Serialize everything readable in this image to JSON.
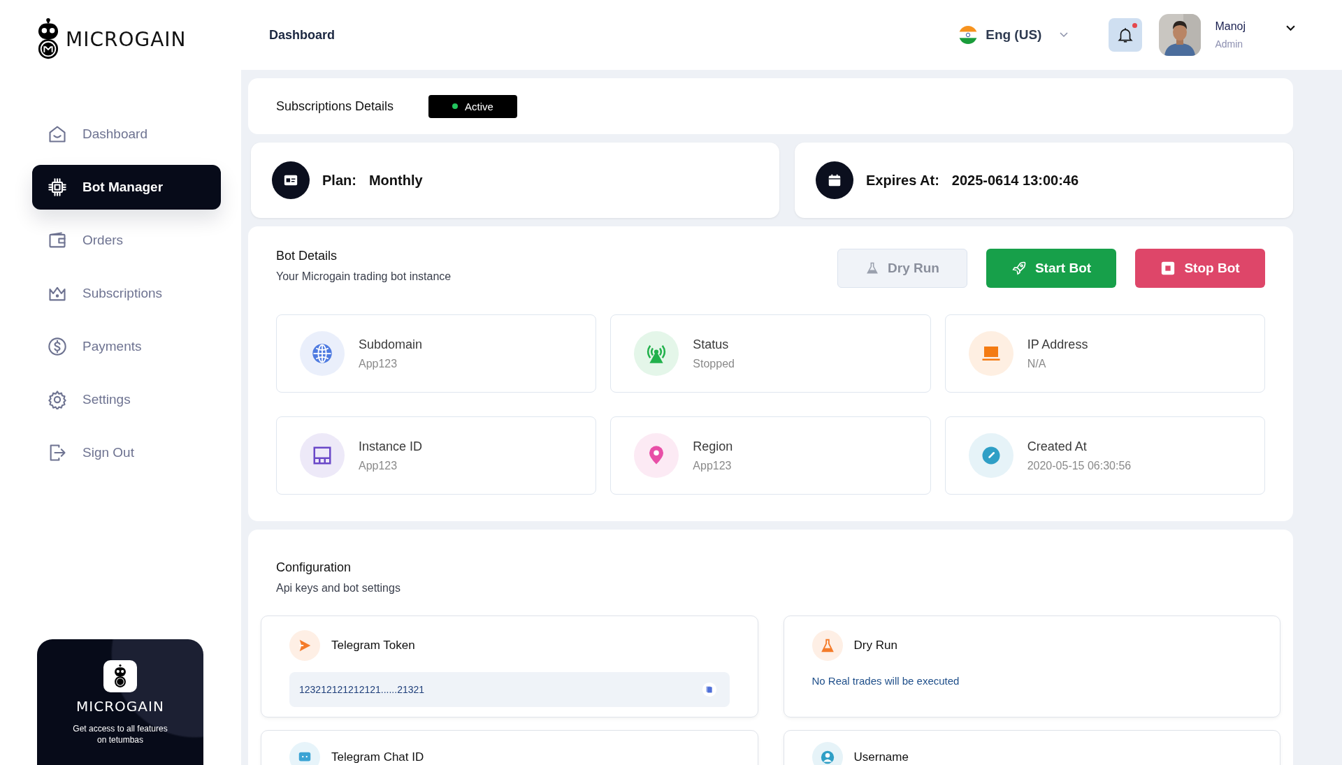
{
  "brand": {
    "name": "MICROGAIN"
  },
  "nav": [
    {
      "label": "Dashboard",
      "selected": false
    },
    {
      "label": "Bot Manager",
      "selected": true
    },
    {
      "label": "Orders",
      "selected": false
    },
    {
      "label": "Subscriptions",
      "selected": false
    },
    {
      "label": "Payments",
      "selected": false
    },
    {
      "label": "Settings",
      "selected": false
    },
    {
      "label": "Sign Out",
      "selected": false
    }
  ],
  "promo": {
    "brand": "MICROGAIN",
    "text": "Get access to all features on tetumbas"
  },
  "header": {
    "title": "Dashboard",
    "language": "Eng (US)",
    "notifications_unread": true,
    "user": {
      "name": "Manoj",
      "role": "Admin"
    }
  },
  "subscription": {
    "title": "Subscriptions Details",
    "status": {
      "label": "Active",
      "color": "#22c55e"
    }
  },
  "plan": {
    "label": "Plan:",
    "value": "Monthly"
  },
  "expires": {
    "label": "Expires At:",
    "value": "2025-0614 13:00:46"
  },
  "bot_details": {
    "title": "Bot Details",
    "subtitle": "Your Microgain trading bot  instance",
    "buttons": [
      {
        "label": "Dry Run",
        "kind": "secondary"
      },
      {
        "label": "Start Bot",
        "kind": "success"
      },
      {
        "label": "Stop Bot",
        "kind": "danger"
      }
    ],
    "items": [
      {
        "label": "Subdomain",
        "value": "App123",
        "color": "#4f7be0"
      },
      {
        "label": "Status",
        "value": "Stopped",
        "color": "#22b14c"
      },
      {
        "label": "IP Address",
        "value": "N/A",
        "color": "#f47b12"
      },
      {
        "label": "Instance ID",
        "value": "App123",
        "color": "#6a48c8"
      },
      {
        "label": "Region",
        "value": "App123",
        "color": "#e84fa7"
      },
      {
        "label": "Created At",
        "value": "2020-05-15  06:30:56",
        "color": "#2f9fc6"
      }
    ]
  },
  "configuration": {
    "title": "Configuration",
    "subtitle": "Api keys and bot settings",
    "items": [
      {
        "label": "Telegram Token",
        "kind": "field",
        "value": "123212121212121......21321",
        "color": "#f47b2a"
      },
      {
        "label": "Dry Run",
        "kind": "note",
        "value": "No Real trades will be executed",
        "color": "#f47b2a"
      },
      {
        "label": "Telegram Chat ID",
        "kind": "title",
        "color": "#3aa3d4"
      },
      {
        "label": "Username",
        "kind": "title",
        "color": "#2f9fc6"
      }
    ]
  }
}
